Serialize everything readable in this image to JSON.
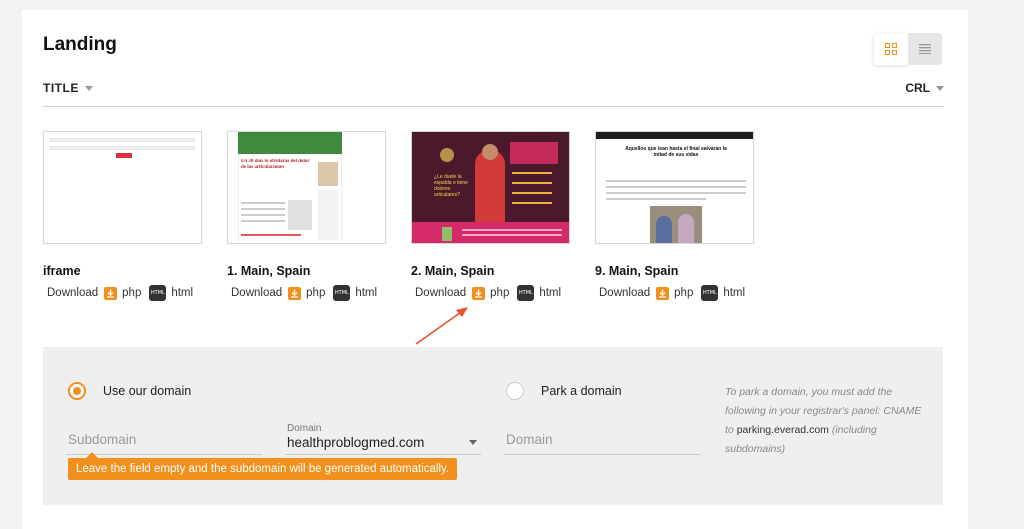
{
  "page": {
    "title": "Landing"
  },
  "columns": {
    "title": "TITLE",
    "crl": "CRL"
  },
  "view_toggle": {
    "grid_icon": "grid-icon",
    "list_icon": "list-icon"
  },
  "tiles": [
    {
      "name": "iframe",
      "download": "Download",
      "php": "php",
      "html": "html",
      "html_badge": "HTML"
    },
    {
      "name": "1. Main, Spain",
      "download": "Download",
      "php": "php",
      "html": "html",
      "html_badge": "HTML",
      "headline": "En 30 días te olvidarás del dolor de las articulaciones"
    },
    {
      "name": "2. Main, Spain",
      "download": "Download",
      "php": "php",
      "html": "html",
      "html_badge": "HTML",
      "headline": "¿Le duele la espalda o tiene dolores articulares?"
    },
    {
      "name": "9. Main, Spain",
      "download": "Download",
      "php": "php",
      "html": "html",
      "html_badge": "HTML",
      "headline": "Aquellos que lean hasta el final salvarán la mitad de sus vidas"
    }
  ],
  "domain": {
    "use_our_domain": "Use our domain",
    "park_a_domain": "Park a domain",
    "subdomain_placeholder": "Subdomain",
    "domain_label": "Domain",
    "domain_value": "healthproblogmed.com",
    "park_placeholder": "Domain",
    "tooltip": "Leave the field empty and the subdomain will be generated automatically.",
    "hint_1": "To park a domain, you must add the following in your registrar's panel: CNAME to ",
    "hint_cname": "parking.everad.com",
    "hint_2": " (including subdomains)"
  },
  "colors": {
    "accent": "#f2901e",
    "panel": "#efefef",
    "arrow": "#e8532b"
  }
}
